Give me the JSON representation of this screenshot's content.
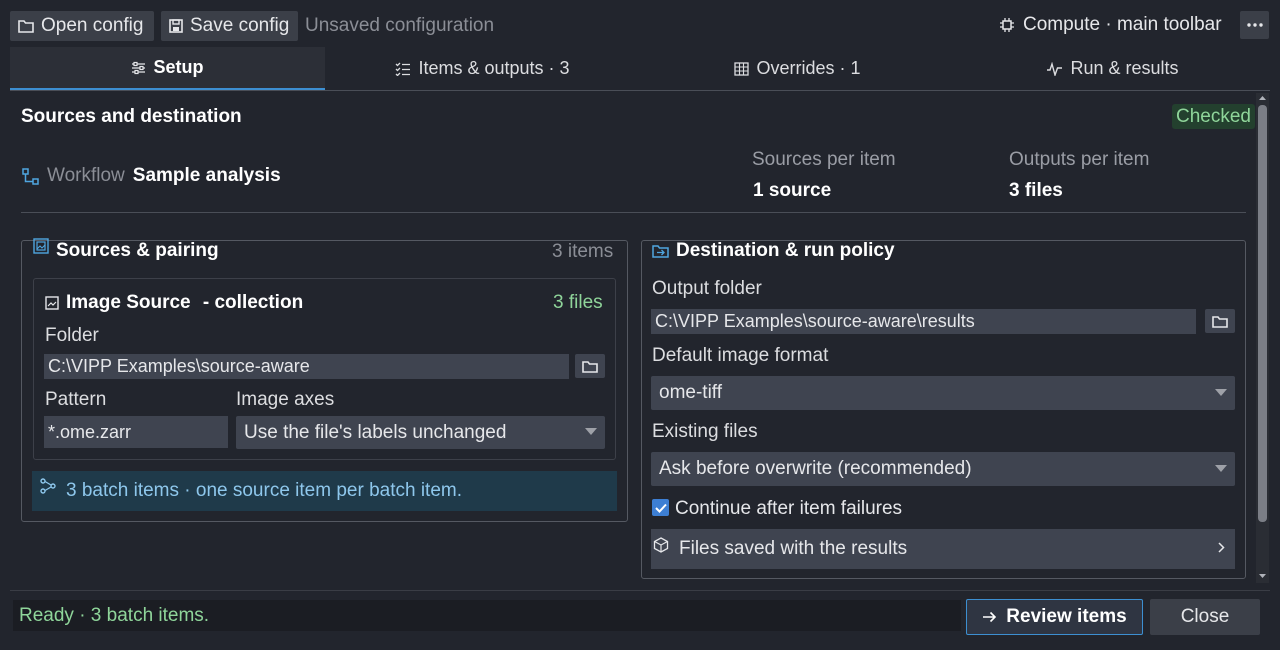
{
  "toolbar": {
    "open_label": "Open config",
    "save_label": "Save config",
    "status_title": "Unsaved configuration",
    "compute_label": "Compute · main toolbar"
  },
  "tabs": [
    {
      "label": "Setup",
      "active": true,
      "icon": "sliders-icon"
    },
    {
      "label": "Items & outputs · 3",
      "active": false,
      "icon": "checklist-icon"
    },
    {
      "label": "Overrides · 1",
      "active": false,
      "icon": "table-icon"
    },
    {
      "label": "Run & results",
      "active": false,
      "icon": "pulse-icon"
    }
  ],
  "section": {
    "title": "Sources and destination",
    "badge": "Checked",
    "workflow_prefix": "Workflow",
    "workflow_name": "Sample analysis",
    "sources_per_item_label": "Sources per item",
    "sources_per_item_value": "1 source",
    "outputs_per_item_label": "Outputs per item",
    "outputs_per_item_value": "3 files"
  },
  "sources_panel": {
    "title": "Sources & pairing",
    "count": "3 items",
    "source": {
      "title": "Image Source",
      "subtitle": " - collection",
      "files": "3 files",
      "folder_label": "Folder",
      "folder_value": "C:\\VIPP Examples\\source-aware",
      "pattern_label": "Pattern",
      "pattern_value": "*.ome.zarr",
      "axes_label": "Image axes",
      "axes_value": "Use the file's labels unchanged"
    },
    "info": "3 batch items · one source item per batch item."
  },
  "destination_panel": {
    "title": "Destination & run policy",
    "output_label": "Output folder",
    "output_value": "C:\\VIPP Examples\\source-aware\\results",
    "format_label": "Default image format",
    "format_value": "ome-tiff",
    "existing_label": "Existing files",
    "existing_value": "Ask before overwrite (recommended)",
    "continue_label": "Continue after item failures",
    "continue_checked": true,
    "files_saved_label": "Files saved with the results"
  },
  "footer": {
    "status": "Ready · 3 batch items.",
    "review_label": "Review items",
    "close_label": "Close"
  },
  "colors": {
    "background": "#22252d",
    "accent": "#3d8fd1",
    "success": "#8fd59a",
    "info": "#8ec7ec"
  }
}
